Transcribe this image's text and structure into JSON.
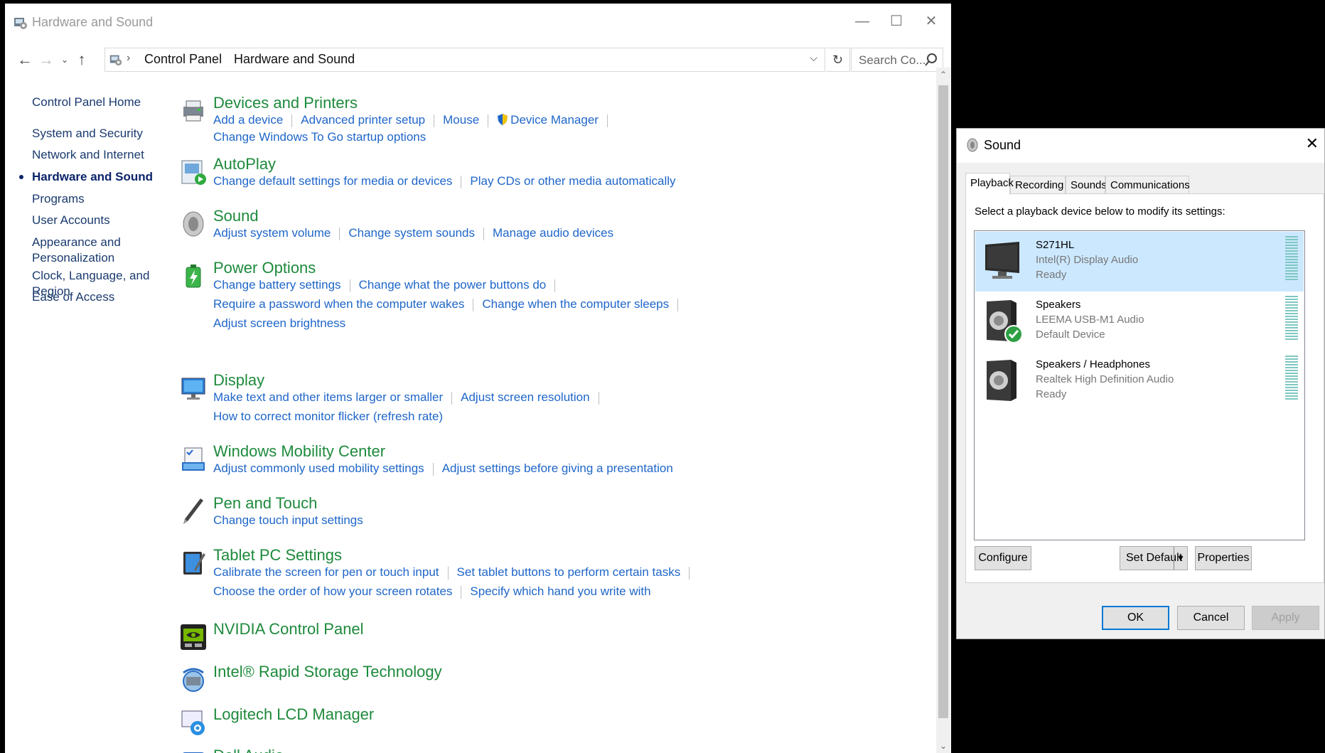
{
  "control_panel": {
    "window_title": "Hardware and Sound",
    "breadcrumb": [
      "Control Panel",
      "Hardware and Sound"
    ],
    "search_placeholder": "Search Co...",
    "left_nav": [
      {
        "label": "Control Panel Home",
        "active": false
      },
      {
        "label": "System and Security",
        "active": false
      },
      {
        "label": "Network and Internet",
        "active": false
      },
      {
        "label": "Hardware and Sound",
        "active": true
      },
      {
        "label": "Programs",
        "active": false
      },
      {
        "label": "User Accounts",
        "active": false
      },
      {
        "label": "Appearance and Personalization",
        "active": false
      },
      {
        "label": "Clock, Language, and Region",
        "active": false
      },
      {
        "label": "Ease of Access",
        "active": false
      }
    ],
    "categories": [
      {
        "title": "Devices and Printers",
        "icon": "printer-icon",
        "rows": [
          [
            "Add a device",
            "Advanced printer setup",
            "Mouse",
            "Device Manager"
          ],
          [
            "Change Windows To Go startup options"
          ]
        ]
      },
      {
        "title": "AutoPlay",
        "icon": "autoplay-icon",
        "rows": [
          [
            "Change default settings for media or devices",
            "Play CDs or other media automatically"
          ]
        ]
      },
      {
        "title": "Sound",
        "icon": "speaker-icon",
        "rows": [
          [
            "Adjust system volume",
            "Change system sounds",
            "Manage audio devices"
          ]
        ]
      },
      {
        "title": "Power Options",
        "icon": "battery-icon",
        "rows": [
          [
            "Change battery settings",
            "Change what the power buttons do"
          ],
          [
            "Require a password when the computer wakes",
            "Change when the computer sleeps"
          ],
          [
            "Adjust screen brightness"
          ]
        ]
      },
      {
        "title": "Display",
        "icon": "monitor-icon",
        "rows": [
          [
            "Make text and other items larger or smaller",
            "Adjust screen resolution"
          ],
          [
            "How to correct monitor flicker (refresh rate)"
          ]
        ]
      },
      {
        "title": "Windows Mobility Center",
        "icon": "mobility-icon",
        "rows": [
          [
            "Adjust commonly used mobility settings",
            "Adjust settings before giving a presentation"
          ]
        ]
      },
      {
        "title": "Pen and Touch",
        "icon": "pen-icon",
        "rows": [
          [
            "Change touch input settings"
          ]
        ]
      },
      {
        "title": "Tablet PC Settings",
        "icon": "tablet-icon",
        "rows": [
          [
            "Calibrate the screen for pen or touch input",
            "Set tablet buttons to perform certain tasks"
          ],
          [
            "Choose the order of how your screen rotates",
            "Specify which hand you write with"
          ]
        ]
      },
      {
        "title": "NVIDIA Control Panel",
        "icon": "nvidia-icon",
        "rows": []
      },
      {
        "title": "Intel® Rapid Storage Technology",
        "icon": "intel-rst-icon",
        "rows": []
      },
      {
        "title": "Logitech LCD Manager",
        "icon": "logitech-icon",
        "rows": []
      },
      {
        "title": "Dell Audio",
        "icon": "dell-audio-icon",
        "rows": []
      }
    ]
  },
  "sound_dialog": {
    "title": "Sound",
    "tabs": [
      "Playback",
      "Recording",
      "Sounds",
      "Communications"
    ],
    "selected_tab": "Playback",
    "instruction": "Select a playback device below to modify its settings:",
    "devices": [
      {
        "name": "S271HL",
        "driver": "Intel(R) Display Audio",
        "status": "Ready",
        "icon": "monitor-icon",
        "selected": true
      },
      {
        "name": "Speakers",
        "driver": "LEEMA USB-M1 Audio",
        "status": "Default Device",
        "icon": "speaker-default-icon",
        "selected": false
      },
      {
        "name": "Speakers / Headphones",
        "driver": "Realtek High Definition Audio",
        "status": "Ready",
        "icon": "speaker-icon",
        "selected": false
      }
    ],
    "buttons": {
      "configure": "Configure",
      "set_default": "Set Default",
      "properties": "Properties",
      "ok": "OK",
      "cancel": "Cancel",
      "apply": "Apply"
    }
  }
}
